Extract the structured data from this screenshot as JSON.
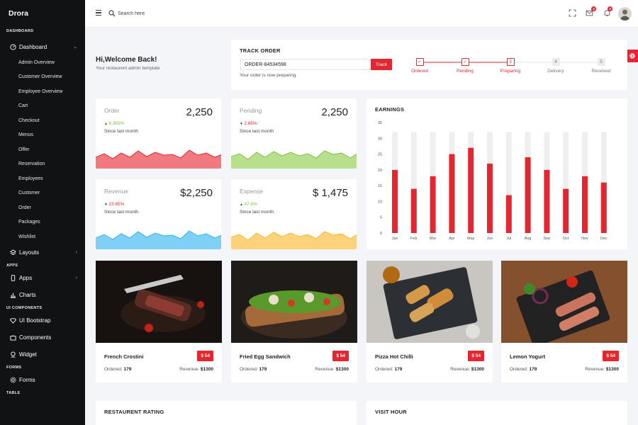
{
  "brand": "Drora",
  "colors": {
    "accent": "#e3262f",
    "sidebar": "#111214"
  },
  "sidebar": {
    "section_dashboard": "DASHBOARD",
    "dashboard": {
      "label": "Dashboard",
      "icon": "gauge-icon"
    },
    "dashboard_items": [
      "Admin Overview",
      "Customer Overview",
      "Employee Overview",
      "Cart",
      "Checkout",
      "Menus",
      "Offer",
      "Reservation",
      "Employees",
      "Customer",
      "Order",
      "Packages",
      "Wishlist"
    ],
    "layouts": {
      "label": "Layouts",
      "icon": "layers-icon"
    },
    "section_apps": "APPS",
    "apps": {
      "label": "Apps",
      "icon": "mobile-icon"
    },
    "charts": {
      "label": "Charts",
      "icon": "bar-chart-icon"
    },
    "section_ui": "UI COMPONENTS",
    "ui_bootstrap": {
      "label": "UI Bootstrap",
      "icon": "diamond-icon"
    },
    "components": {
      "label": "Components",
      "icon": "puzzle-icon"
    },
    "widget": {
      "label": "Widget",
      "icon": "widget-icon"
    },
    "section_forms": "FORMS",
    "forms": {
      "label": "Forms",
      "icon": "gear-icon"
    },
    "section_table": "TABLE"
  },
  "topbar": {
    "search_placeholder": "Search here",
    "mail_badge": "3",
    "bell_badge": "3"
  },
  "welcome": {
    "title": "Hi,Welcome Back!",
    "subtitle": "Your restaurent admin template"
  },
  "track": {
    "title": "TRACK ORDER",
    "order_value": "ORDER-84534598",
    "button": "Track",
    "status": "Your order is now preparing",
    "steps": [
      {
        "mark": "✓",
        "label": "Ordered",
        "active": true
      },
      {
        "mark": "✓",
        "label": "Pending",
        "active": true
      },
      {
        "mark": "3",
        "label": "Preparing",
        "active": true
      },
      {
        "mark": "4",
        "label": "Delivery",
        "active": false
      },
      {
        "mark": "5",
        "label": "Received",
        "active": false
      }
    ]
  },
  "stats": [
    {
      "label": "Order",
      "value": "2,250",
      "pct": "6,365%",
      "dir": "up",
      "pct_color": "#7cc243",
      "since": "Since last month",
      "fill": "#f07a7f",
      "line": "#e3262f"
    },
    {
      "label": "Pending",
      "value": "2,250",
      "pct": "2.65%",
      "dir": "down",
      "pct_color": "#e3262f",
      "since": "Since last month",
      "fill": "#b7df8c",
      "line": "#7cc243"
    },
    {
      "label": "Revenue",
      "value": "$2,250",
      "pct": "23.65%",
      "dir": "down",
      "pct_color": "#e3262f",
      "since": "Since last month",
      "fill": "#7fd0f5",
      "line": "#2fb1ec"
    },
    {
      "label": "Expense",
      "value": "$ 1,475",
      "pct": "47.5%",
      "dir": "up",
      "pct_color": "#7cc243",
      "since": "Since last month",
      "fill": "#fcd27b",
      "line": "#f5b731"
    }
  ],
  "earnings_title": "EARNINGS",
  "chart_data": {
    "type": "bar",
    "title": "EARNINGS",
    "categories": [
      "Jan",
      "Feb",
      "Mar",
      "Apr",
      "May",
      "Jun",
      "Jul",
      "Aug",
      "Sep",
      "Oct",
      "Nov",
      "Dec"
    ],
    "values": [
      20,
      14,
      18,
      25,
      27,
      22,
      12,
      24,
      20,
      14,
      18,
      16
    ],
    "background_max": 32,
    "ylim": [
      0,
      35
    ],
    "yticks": [
      0,
      5,
      10,
      15,
      20,
      25,
      30,
      35
    ],
    "grid": false,
    "bar_color": "#e3262f",
    "bg_bar_color": "#eeeff1"
  },
  "foods": [
    {
      "name": "French Crostini",
      "price": "$ 54",
      "ordered_label": "Ordered:",
      "ordered": "179",
      "revenue_label": "Revenue:",
      "revenue": "$1300"
    },
    {
      "name": "Fried Egg Sandwich",
      "price": "$ 54",
      "ordered_label": "Ordered:",
      "ordered": "179",
      "revenue_label": "Revenue:",
      "revenue": "$1300"
    },
    {
      "name": "Pizza Hot Chilli",
      "price": "$ 54",
      "ordered_label": "Ordered:",
      "ordered": "179",
      "revenue_label": "Revenue:",
      "revenue": "$1300"
    },
    {
      "name": "Lemon Yogurt",
      "price": "$ 54",
      "ordered_label": "Ordered:",
      "ordered": "179",
      "revenue_label": "Revenue:",
      "revenue": "$1300"
    }
  ],
  "rating_title": "RESTAURENT RATING",
  "visit_title": "VISIT HOUR"
}
